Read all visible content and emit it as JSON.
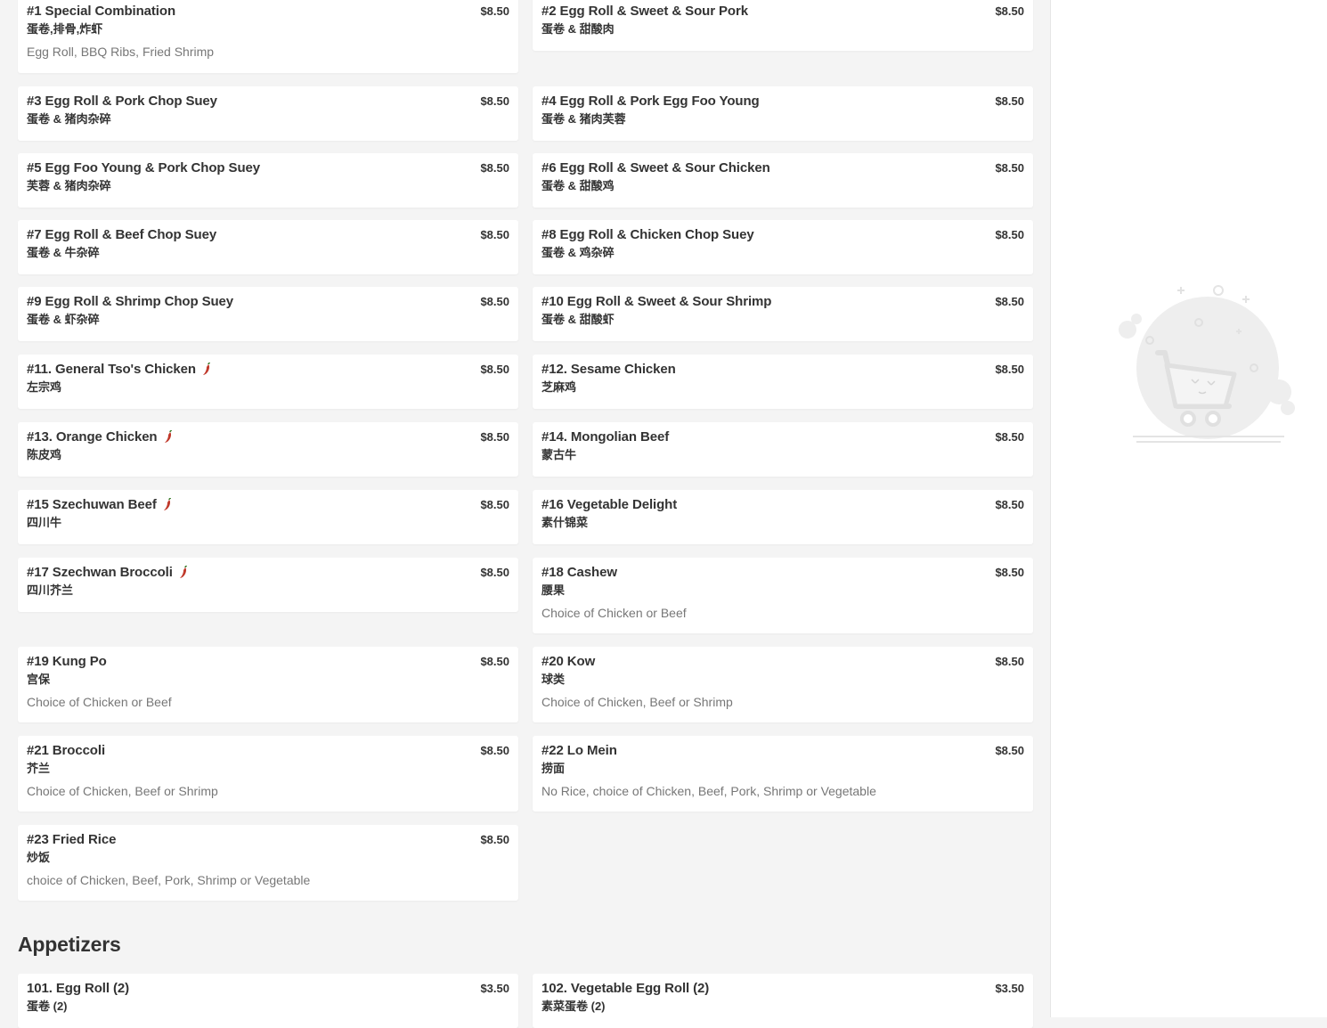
{
  "menu_items": [
    {
      "name": "#1 Special Combination",
      "price": "$8.50",
      "chinese": "蛋卷,排骨,炸虾",
      "description": "Egg Roll, BBQ Ribs, Fried Shrimp",
      "spicy": false
    },
    {
      "name": "#2 Egg Roll & Sweet & Sour Pork",
      "price": "$8.50",
      "chinese": "蛋卷 & 甜酸肉",
      "description": "",
      "spicy": false
    },
    {
      "name": "#3 Egg Roll & Pork Chop Suey",
      "price": "$8.50",
      "chinese": "蛋卷 & 猪肉杂碎",
      "description": "",
      "spicy": false
    },
    {
      "name": "#4 Egg Roll & Pork Egg Foo Young",
      "price": "$8.50",
      "chinese": "蛋卷 & 猪肉芙蓉",
      "description": "",
      "spicy": false
    },
    {
      "name": "#5 Egg Foo Young & Pork Chop Suey",
      "price": "$8.50",
      "chinese": "芙蓉 & 猪肉杂碎",
      "description": "",
      "spicy": false
    },
    {
      "name": "#6 Egg Roll & Sweet & Sour Chicken",
      "price": "$8.50",
      "chinese": "蛋卷 & 甜酸鸡",
      "description": "",
      "spicy": false
    },
    {
      "name": "#7 Egg Roll & Beef Chop Suey",
      "price": "$8.50",
      "chinese": "蛋卷 & 牛杂碎",
      "description": "",
      "spicy": false
    },
    {
      "name": "#8 Egg Roll & Chicken Chop Suey",
      "price": "$8.50",
      "chinese": "蛋卷 & 鸡杂碎",
      "description": "",
      "spicy": false
    },
    {
      "name": "#9 Egg Roll & Shrimp Chop Suey",
      "price": "$8.50",
      "chinese": "蛋卷 & 虾杂碎",
      "description": "",
      "spicy": false
    },
    {
      "name": "#10 Egg Roll & Sweet & Sour Shrimp",
      "price": "$8.50",
      "chinese": "蛋卷 & 甜酸虾",
      "description": "",
      "spicy": false
    },
    {
      "name": "#11. General Tso's Chicken",
      "price": "$8.50",
      "chinese": "左宗鸡",
      "description": "",
      "spicy": true
    },
    {
      "name": "#12. Sesame Chicken",
      "price": "$8.50",
      "chinese": "芝麻鸡",
      "description": "",
      "spicy": false
    },
    {
      "name": "#13. Orange Chicken",
      "price": "$8.50",
      "chinese": "陈皮鸡",
      "description": "",
      "spicy": true
    },
    {
      "name": "#14. Mongolian Beef",
      "price": "$8.50",
      "chinese": "蒙古牛",
      "description": "",
      "spicy": false
    },
    {
      "name": "#15 Szechuwan Beef",
      "price": "$8.50",
      "chinese": "四川牛",
      "description": "",
      "spicy": true
    },
    {
      "name": "#16 Vegetable Delight",
      "price": "$8.50",
      "chinese": "素什锦菜",
      "description": "",
      "spicy": false
    },
    {
      "name": "#17 Szechwan Broccoli",
      "price": "$8.50",
      "chinese": "四川芥兰",
      "description": "",
      "spicy": true
    },
    {
      "name": "#18 Cashew",
      "price": "$8.50",
      "chinese": "腰果",
      "description": "Choice of Chicken or Beef",
      "spicy": false
    },
    {
      "name": "#19 Kung Po",
      "price": "$8.50",
      "chinese": "宫保",
      "description": "Choice of Chicken or Beef",
      "spicy": false
    },
    {
      "name": "#20 Kow",
      "price": "$8.50",
      "chinese": "球类",
      "description": "Choice of Chicken, Beef or Shrimp",
      "spicy": false
    },
    {
      "name": "#21 Broccoli",
      "price": "$8.50",
      "chinese": "芥兰",
      "description": "Choice of Chicken, Beef or Shrimp",
      "spicy": false
    },
    {
      "name": "#22 Lo Mein",
      "price": "$8.50",
      "chinese": "捞面",
      "description": "No Rice, choice of Chicken, Beef, Pork, Shrimp or Vegetable",
      "spicy": false
    },
    {
      "name": "#23 Fried Rice",
      "price": "$8.50",
      "chinese": "炒饭",
      "description": "choice of Chicken, Beef, Pork, Shrimp or Vegetable",
      "spicy": false
    }
  ],
  "appetizers": {
    "heading": "Appetizers",
    "items": [
      {
        "name": "101. Egg Roll (2)",
        "price": "$3.50",
        "chinese": "蛋卷 (2)",
        "description": "",
        "spicy": false
      },
      {
        "name": "102. Vegetable Egg Roll (2)",
        "price": "$3.50",
        "chinese": "素菜蛋卷 (2)",
        "description": "",
        "spicy": false
      }
    ]
  },
  "cart": {
    "icon": "empty-cart-icon"
  },
  "colors": {
    "background": "#f4f4f4",
    "card": "#ffffff",
    "text": "#333333",
    "muted": "#777777",
    "chili": "#c0392b"
  }
}
